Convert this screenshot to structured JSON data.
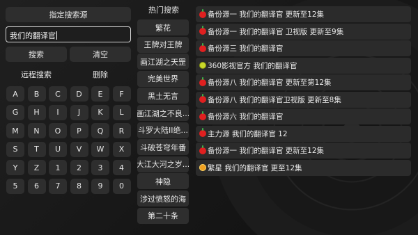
{
  "search": {
    "title": "指定搜索源",
    "query": "我们的翻译官",
    "search_label": "搜索",
    "clear_label": "清空",
    "remote_label": "远程搜索",
    "delete_label": "删除"
  },
  "keyboard": {
    "keys": [
      "A",
      "B",
      "C",
      "D",
      "E",
      "F",
      "G",
      "H",
      "I",
      "J",
      "K",
      "L",
      "M",
      "N",
      "O",
      "P",
      "Q",
      "R",
      "S",
      "T",
      "U",
      "V",
      "W",
      "X",
      "Y",
      "Z",
      "1",
      "2",
      "3",
      "4",
      "5",
      "6",
      "7",
      "8",
      "9",
      "0"
    ]
  },
  "hot": {
    "title": "热门搜索",
    "items": [
      "繁花",
      "王牌对王牌",
      "画江湖之天罡",
      "完美世界",
      "黑土无言",
      "画江湖之不良...",
      "斗罗大陆II绝...",
      "斗破苍穹年番",
      "大江大河之岁...",
      "神隐",
      "涉过愤怒的海",
      "第二十条"
    ]
  },
  "results": {
    "items": [
      {
        "icon": "apple-icon",
        "text": "备份源一  我们的翻译官  更新至12集"
      },
      {
        "icon": "apple-icon",
        "text": "备份源一  我们的翻译官 卫视版  更新至9集"
      },
      {
        "icon": "apple-icon",
        "text": "备份源三  我们的翻译官"
      },
      {
        "icon": "ball-icon",
        "text": "360影视官方  我们的翻译官"
      },
      {
        "icon": "apple-icon",
        "text": "备份源八  我们的翻译官  更新至第12集"
      },
      {
        "icon": "apple-icon",
        "text": "备份源八  我们的翻译官卫视版  更新至8集"
      },
      {
        "icon": "apple-icon",
        "text": "备份源六  我们的翻译官"
      },
      {
        "icon": "apple-icon",
        "text": "主力源  我们的翻译官  12"
      },
      {
        "icon": "apple-icon",
        "text": "备份源一  我们的翻译官  更新至12集"
      },
      {
        "icon": "star-icon",
        "text": "繁星  我们的翻译官  更至12集"
      }
    ]
  }
}
